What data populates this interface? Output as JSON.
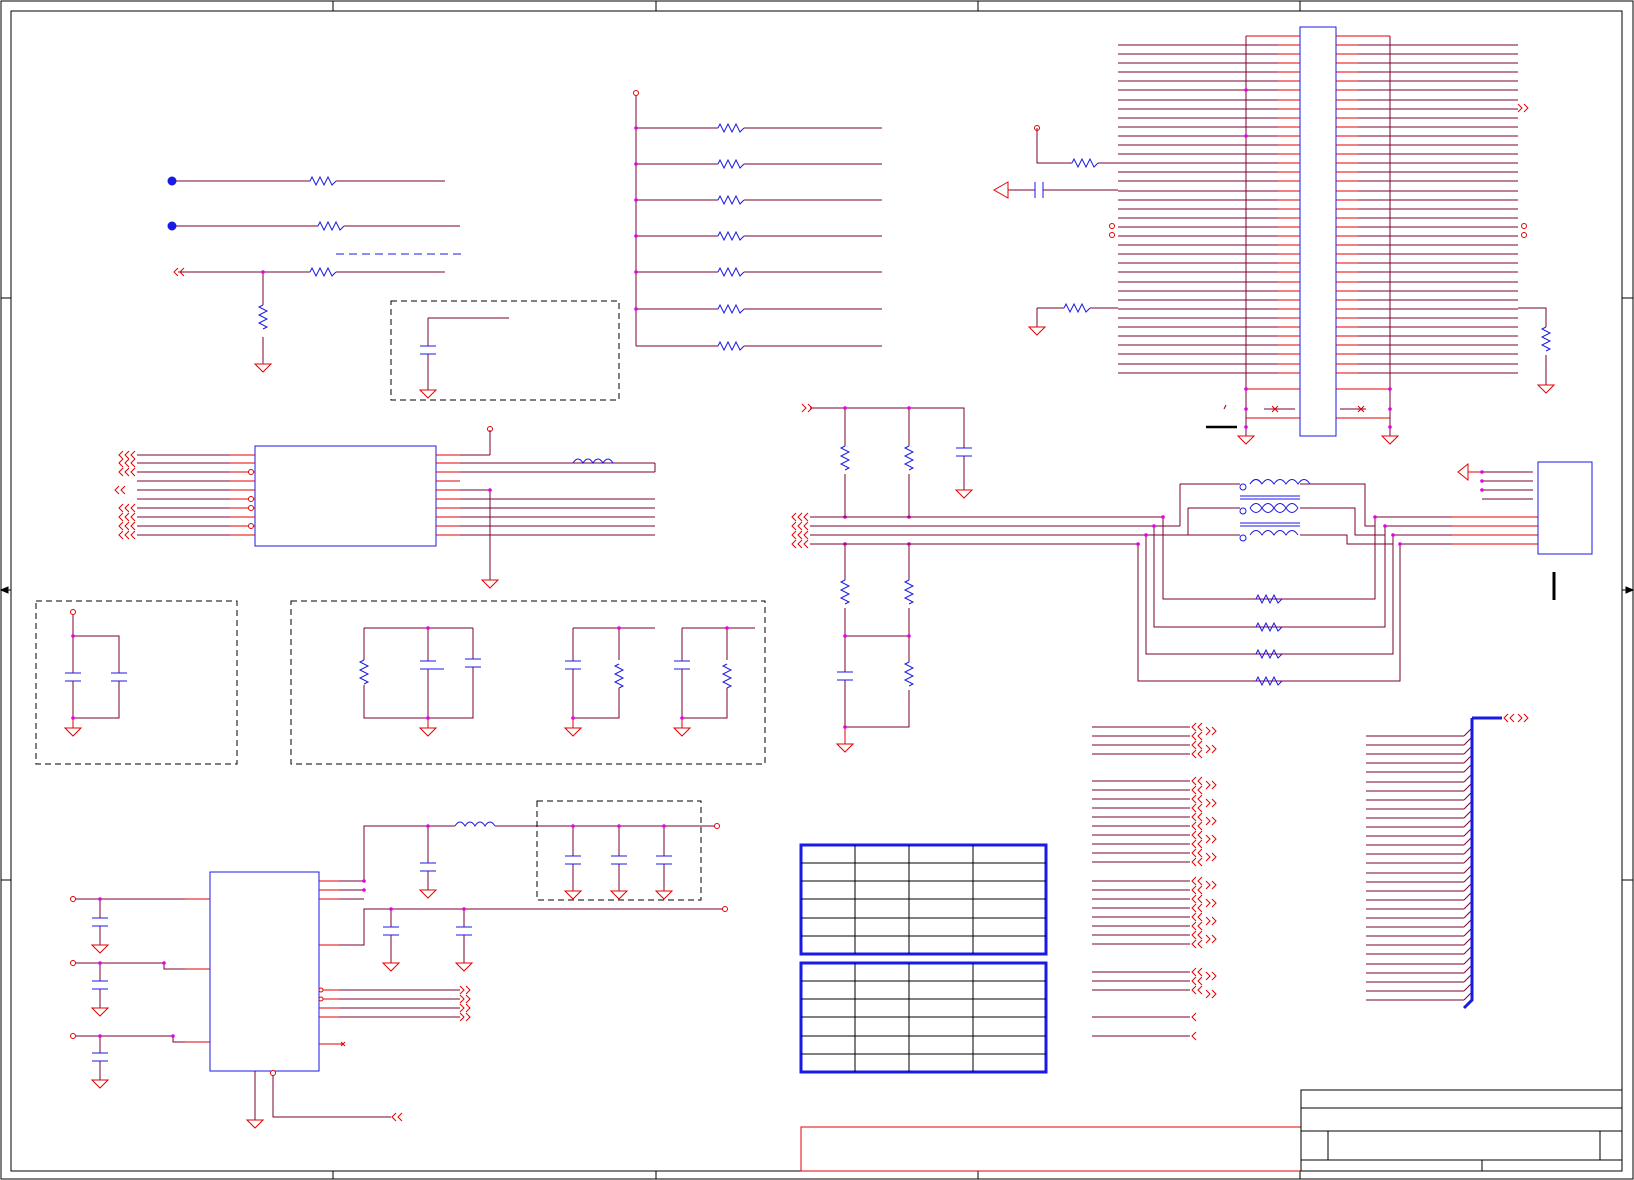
{
  "schematic": {
    "style": {
      "wire": "#7a0033",
      "component": "#1a1ae6",
      "pin": "#e60000",
      "junction": "#e600e6",
      "border": "#000000"
    },
    "sections": [
      "border-frame",
      "left-resistor-nets",
      "pullup-resistor-bank",
      "top-connector-block",
      "dashed-cap-block",
      "left-ic-block",
      "termination-resistors",
      "transformer-block",
      "right-rj-connector",
      "power-decoupling-group",
      "filter-group",
      "regulator-block",
      "regulator-output-caps",
      "signal-bus-left",
      "signal-bus-right",
      "table-1",
      "table-2",
      "title-block"
    ],
    "table_1": {
      "rows": 6,
      "columns": 4
    },
    "table_2": {
      "rows": 6,
      "columns": 4
    }
  }
}
